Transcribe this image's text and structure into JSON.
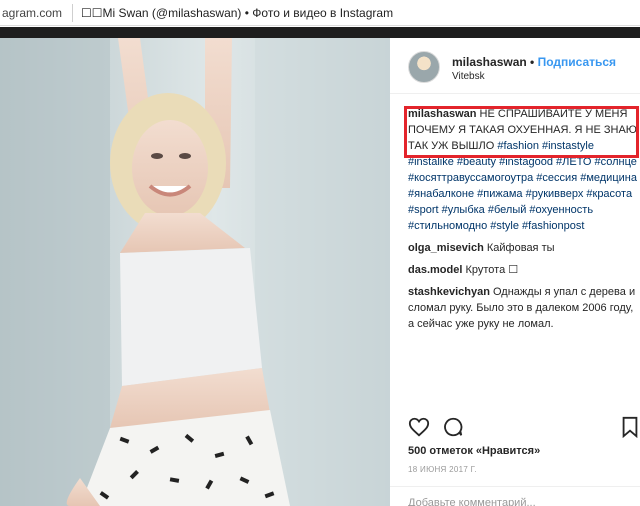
{
  "browser": {
    "url_fragment": "agram.com",
    "tab_title": "☐☐Mi Swan (@milashaswan) • Фото и видео в Instagram"
  },
  "post": {
    "author": "milashaswan",
    "dot": "•",
    "follow_label": "Подписаться",
    "location": "Vitebsk",
    "caption": {
      "user": "milashaswan",
      "text": " НЕ СПРАШИВАЙТЕ У МЕНЯ ПОЧЕМУ Я ТАКАЯ ОХУЕННАЯ. Я НЕ ЗНАЮ, ТАК УЖ ВЫШЛО ",
      "tag1": "#fashion",
      "tag2": "#instastyle",
      "more_tags": "#instalike #beauty #instagood #ЛЕТО #солнце #косяттравуссамогоутра #сессия #медицина #янабалконе #пижама #рукивверх #красота #sport #улыбка #белый #охуенность #стильномодно #style #fashionpost"
    },
    "comments": [
      {
        "user": "olga_misevich",
        "text": " Кайфовая ты"
      },
      {
        "user": "das.model",
        "text": " Крутота ☐"
      },
      {
        "user": "stashkevichyan",
        "text": " Однажды я упал с дерева и сломал руку. Было это в далеком 2006 году, а сейчас уже руку не ломал."
      }
    ],
    "likes": "500 отметок «Нравится»",
    "date": "18 ИЮНЯ 2017 Г.",
    "add_comment_placeholder": "Добавьте комментарий..."
  },
  "icons": {
    "like": "heart-icon",
    "comment": "speech-bubble-icon",
    "save": "bookmark-icon"
  },
  "colors": {
    "link_blue": "#3897f0",
    "hashtag": "#003569",
    "highlight_border": "#e3242b",
    "backdrop": "#1e1e1e"
  }
}
